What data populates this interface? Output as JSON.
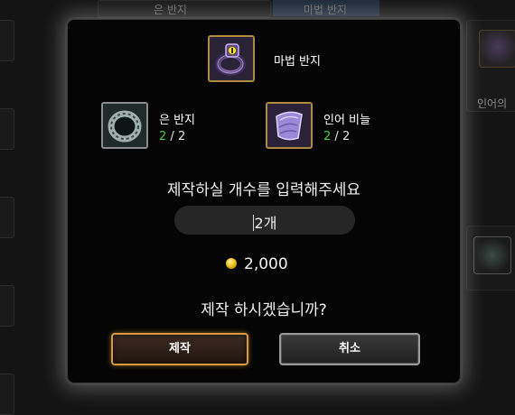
{
  "background": {
    "tab_labels": [
      "은 반지",
      "마법 반지"
    ],
    "side_label": "인어의"
  },
  "dialog": {
    "result_item": {
      "name": "마법 반지",
      "icon": "magic-ring-icon"
    },
    "materials": [
      {
        "name": "은 반지",
        "icon": "silver-ring-icon",
        "have": "2",
        "sep": "/",
        "need": "2"
      },
      {
        "name": "인어 비늘",
        "icon": "mermaid-scale-icon",
        "have": "2",
        "sep": "/",
        "need": "2"
      }
    ],
    "prompt": "제작하실 개수를 입력해주세요",
    "quantity_value": "2개",
    "cost": "2,000",
    "cost_icon": "gold-coin-icon",
    "confirm_question": "제작 하시겠습니까?",
    "confirm_label": "제작",
    "cancel_label": "취소"
  },
  "colors": {
    "have_count": "#49d046",
    "confirm_border": "#d79a3c",
    "cancel_border": "#9a9a9a",
    "gold_frame": "#b08a3e"
  }
}
